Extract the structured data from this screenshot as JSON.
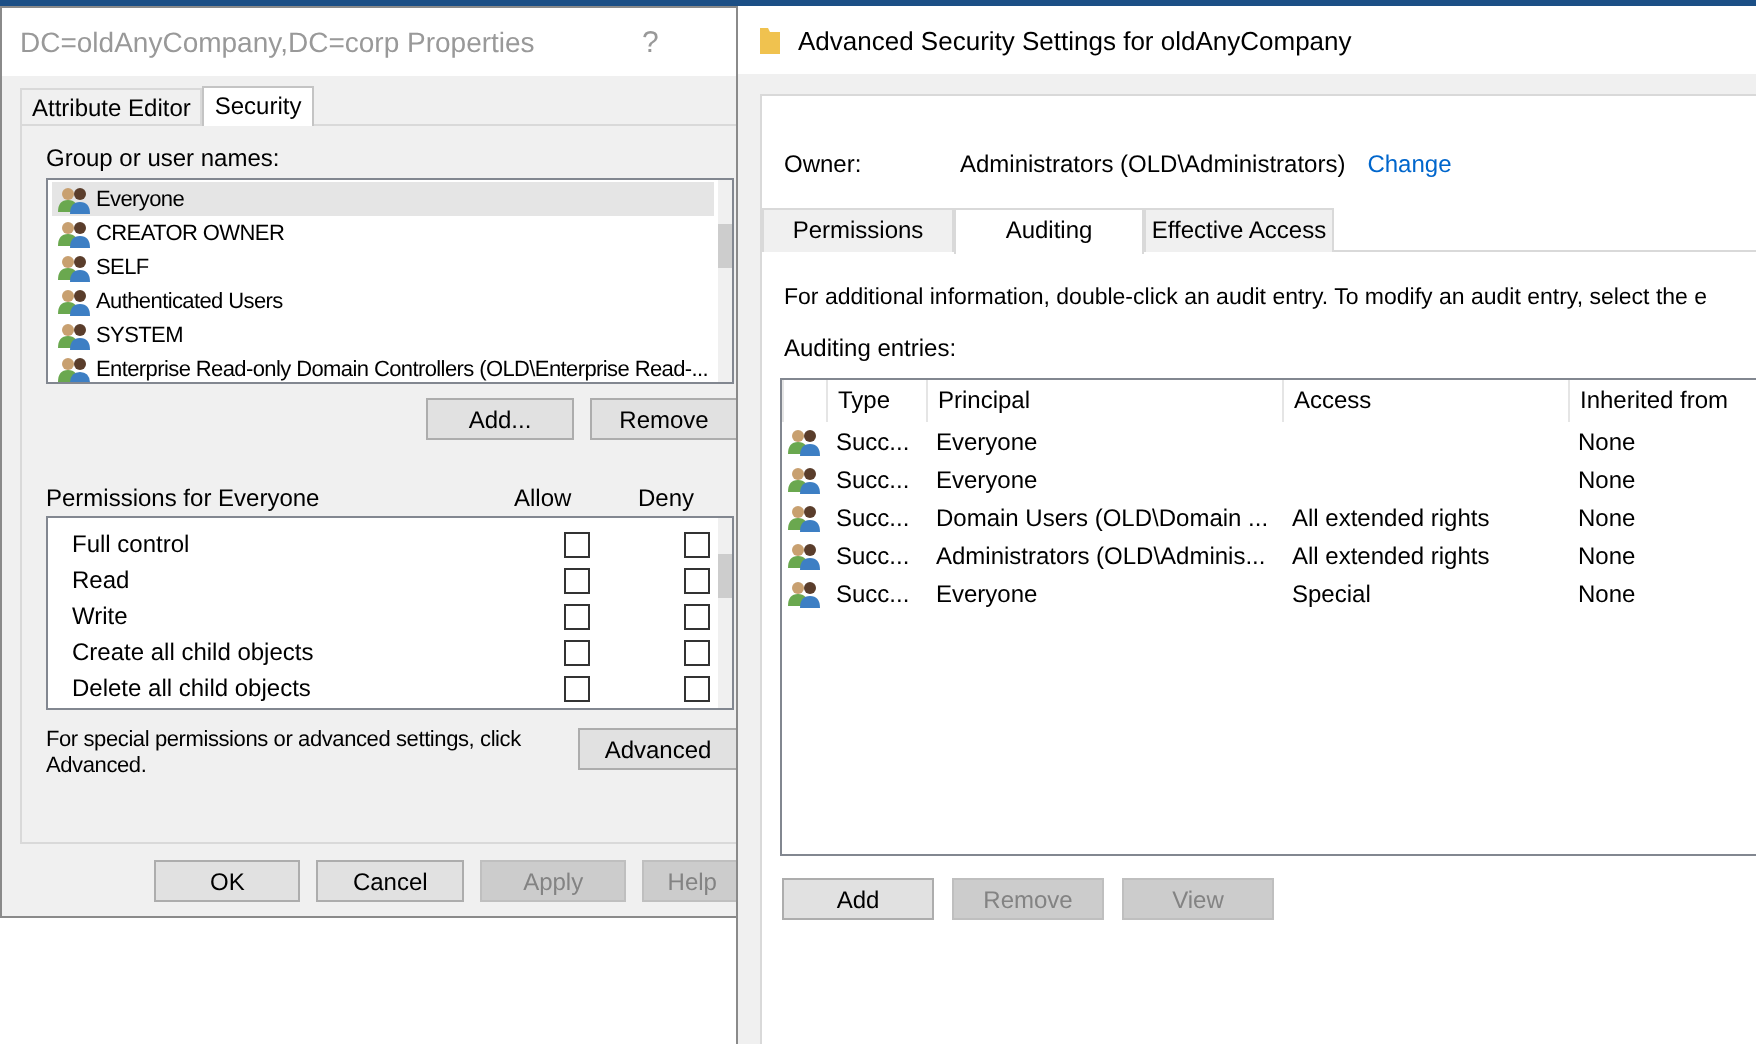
{
  "properties_dialog": {
    "title": "DC=oldAnyCompany,DC=corp Properties",
    "help_glyph": "?",
    "tabs": [
      {
        "label": "Attribute Editor",
        "selected": false
      },
      {
        "label": "Security",
        "selected": true
      }
    ],
    "group_label": "Group or user names:",
    "groups": [
      {
        "name": "Everyone",
        "selected": true
      },
      {
        "name": "CREATOR OWNER",
        "selected": false
      },
      {
        "name": "SELF",
        "selected": false
      },
      {
        "name": "Authenticated Users",
        "selected": false
      },
      {
        "name": "SYSTEM",
        "selected": false
      },
      {
        "name": "Enterprise Read-only Domain Controllers (OLD\\Enterprise Read-...",
        "selected": false
      }
    ],
    "group_buttons": [
      {
        "label": "Add...",
        "disabled": false
      },
      {
        "label": "Remove",
        "disabled": false
      }
    ],
    "permissions_label": "Permissions for Everyone",
    "allow_label": "Allow",
    "deny_label": "Deny",
    "permissions": [
      {
        "name": "Full control",
        "allow": false,
        "deny": false
      },
      {
        "name": "Read",
        "allow": false,
        "deny": false
      },
      {
        "name": "Write",
        "allow": false,
        "deny": false
      },
      {
        "name": "Create all child objects",
        "allow": false,
        "deny": false
      },
      {
        "name": "Delete all child objects",
        "allow": false,
        "deny": false
      }
    ],
    "advanced_note": "For special permissions or advanced settings, click Advanced.",
    "advanced_button": "Advanced",
    "footer_buttons": [
      {
        "label": "OK",
        "disabled": false
      },
      {
        "label": "Cancel",
        "disabled": false
      },
      {
        "label": "Apply",
        "disabled": true
      },
      {
        "label": "Help",
        "disabled": true
      }
    ]
  },
  "advanced_dialog": {
    "title": "Advanced Security Settings for oldAnyCompany",
    "owner_label": "Owner:",
    "owner": "Administrators (OLD\\Administrators)",
    "change_link": "Change",
    "tabs": [
      {
        "label": "Permissions",
        "selected": false
      },
      {
        "label": "Auditing",
        "selected": true
      },
      {
        "label": "Effective Access",
        "selected": false
      }
    ],
    "info": "For additional information, double-click an audit entry. To modify an audit entry, select the e",
    "entries_label": "Auditing entries:",
    "columns": [
      "Type",
      "Principal",
      "Access",
      "Inherited from"
    ],
    "entries": [
      {
        "type": "Succ...",
        "principal": "Everyone",
        "inherited_from": "None"
      },
      {
        "type": "Succ...",
        "principal": "Everyone",
        "inherited_from": "None"
      },
      {
        "type": "Succ...",
        "principal": "Domain Users (OLD\\Domain ...",
        "access": "All extended rights",
        "inherited_from": "None"
      },
      {
        "type": "Succ...",
        "principal": "Administrators (OLD\\Adminis...",
        "access": "All extended rights",
        "inherited_from": "None"
      },
      {
        "type": "Succ...",
        "principal": "Everyone",
        "access": "Special",
        "inherited_from": "None"
      }
    ],
    "buttons": [
      {
        "label": "Add",
        "disabled": false
      },
      {
        "label": "Remove",
        "disabled": true
      },
      {
        "label": "View",
        "disabled": true
      }
    ]
  }
}
